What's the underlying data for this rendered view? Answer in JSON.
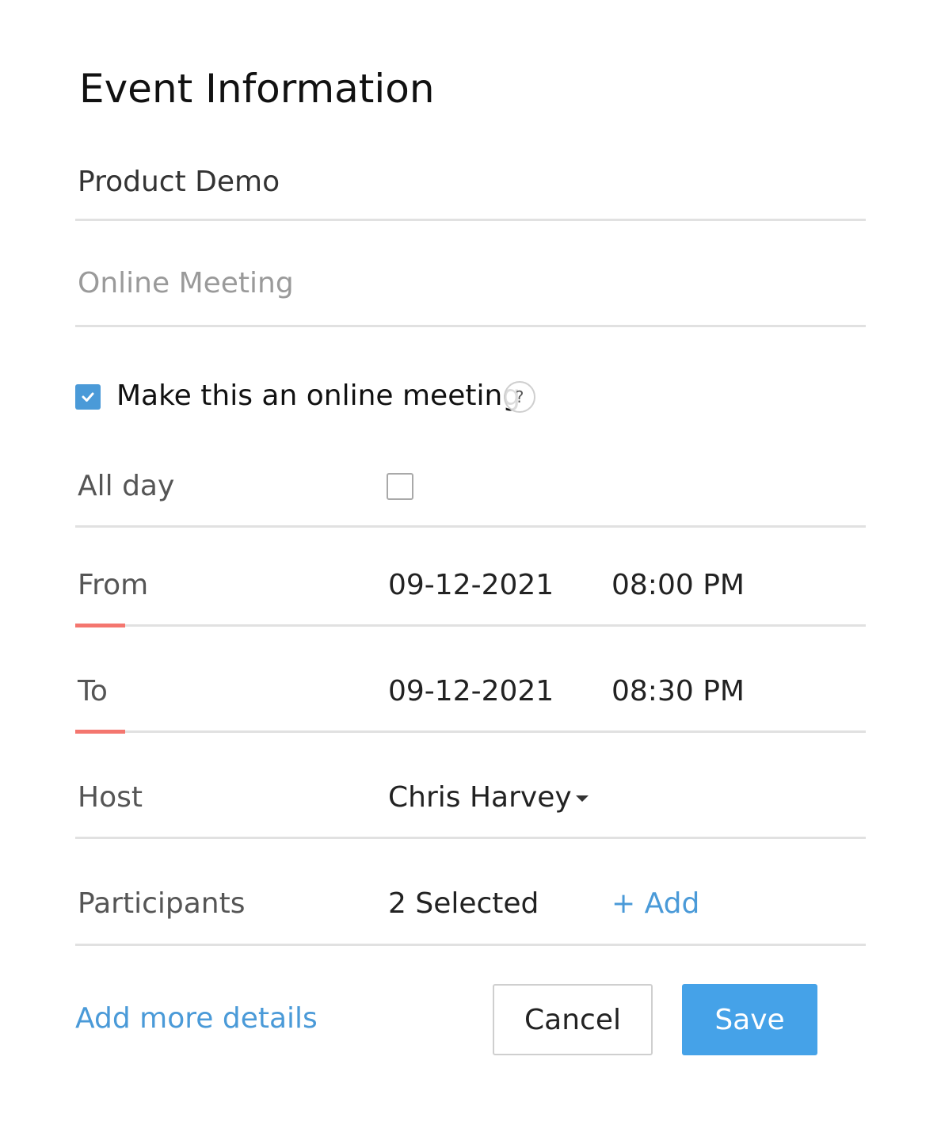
{
  "dialog": {
    "title": "Event Information",
    "event_name": "Product Demo",
    "location_placeholder": "Online Meeting",
    "online_meeting": {
      "label": "Make this an online meeting",
      "checked": true,
      "help_symbol": "?"
    },
    "all_day": {
      "label": "All day",
      "checked": false
    },
    "from": {
      "label": "From",
      "date": "09-12-2021",
      "time": "08:00 PM"
    },
    "to": {
      "label": "To",
      "date": "09-12-2021",
      "time": "08:30 PM"
    },
    "host": {
      "label": "Host",
      "value": "Chris Harvey"
    },
    "participants": {
      "label": "Participants",
      "value": "2 Selected",
      "add_label": "+ Add"
    },
    "footer": {
      "more_details": "Add more details",
      "cancel": "Cancel",
      "save": "Save"
    }
  },
  "colors": {
    "accent_blue": "#45a2e8",
    "required_red": "#f4766f",
    "separator": "#e1e1e1"
  }
}
